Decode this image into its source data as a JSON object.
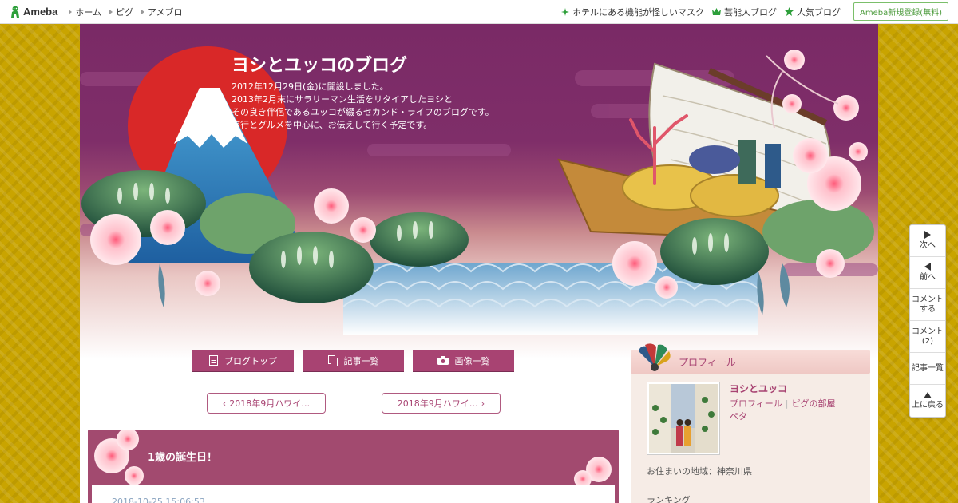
{
  "topbar": {
    "logo": "Ameba",
    "nav_left": [
      "ホーム",
      "ピグ",
      "アメブロ"
    ],
    "nav_right": [
      {
        "label": "ホテルにある機能が怪しいマスク",
        "icon": "sparkle-icon"
      },
      {
        "label": "芸能人ブログ",
        "icon": "crown-icon"
      },
      {
        "label": "人気ブログ",
        "icon": "star-icon"
      }
    ],
    "register": "Ameba新規登録(無料)"
  },
  "header": {
    "title": "ヨシとユッコのブログ",
    "description": [
      "2012年12月29日(金)に開設しました。",
      "2013年2月末にサラリーマン生活をリタイアしたヨシと",
      "その良き伴侶であるユッコが綴るセカンド・ライフのブログです。",
      "旅行とグルメを中心に、お伝えして行く予定です。"
    ]
  },
  "nav_buttons": [
    {
      "label": "ブログトップ",
      "icon": "document-icon"
    },
    {
      "label": "記事一覧",
      "icon": "copy-icon"
    },
    {
      "label": "画像一覧",
      "icon": "camera-icon"
    }
  ],
  "pager": {
    "prev": "2018年9月ハワイ…",
    "next": "2018年9月ハワイ…"
  },
  "article": {
    "title": "1歳の誕生日！",
    "date": "2018-10-25 15:06:53"
  },
  "sidebar": {
    "heading": "プロフィール",
    "name": "ヨシとユッコ",
    "links": [
      "プロフィール",
      "ピグの部屋",
      "ペタ"
    ],
    "area": "お住まいの地域：神奈川県",
    "ranking": "ランキング"
  },
  "floatnav": [
    "次へ",
    "前へ",
    "コメントする",
    "コメント(2)",
    "記事一覧",
    "上に戻る"
  ],
  "colors": {
    "accent": "#a84372",
    "header_purple": "#7a2a66",
    "gold": "#c9a400"
  }
}
